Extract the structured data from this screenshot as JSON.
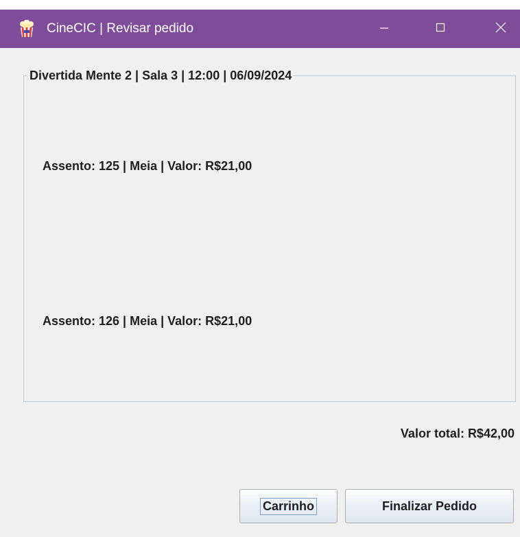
{
  "window": {
    "title": "CineCIC | Revisar pedido",
    "app_icon": "popcorn-icon",
    "controls": {
      "minimize_icon": "minimize-icon",
      "maximize_icon": "maximize-icon",
      "close_icon": "close-icon"
    },
    "colors": {
      "titlebar": "#7f4c9a",
      "background": "#f0f0f0"
    }
  },
  "session": {
    "title": "Divertida Mente 2 | Sala 3 | 12:00 | 06/09/2024"
  },
  "seats": [
    {
      "label": "Assento: 125 | Meia | Valor: R$21,00"
    },
    {
      "label": "Assento: 126 | Meia | Valor: R$21,00"
    }
  ],
  "total": {
    "label": "Valor total: R$42,00"
  },
  "buttons": {
    "cart_label": "Carrinho",
    "finish_label": "Finalizar Pedido"
  }
}
